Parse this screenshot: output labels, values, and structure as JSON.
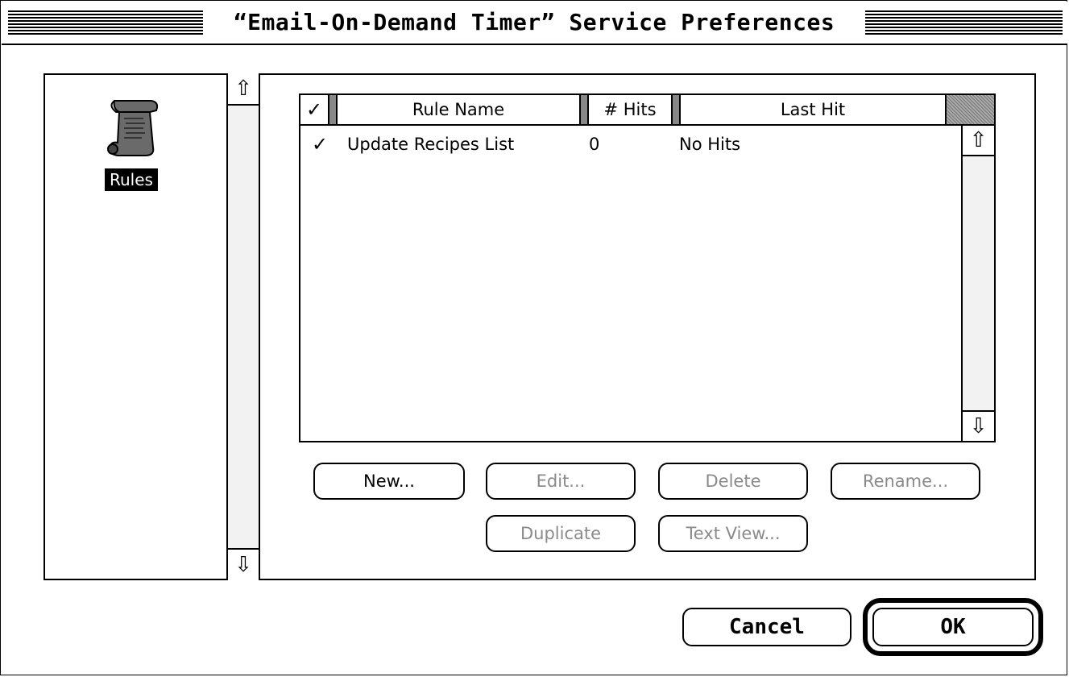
{
  "window": {
    "title": "“Email-On-Demand Timer” Service Preferences"
  },
  "categories": [
    {
      "label": "Rules",
      "icon": "scroll-icon",
      "selected": true
    }
  ],
  "table": {
    "columns": {
      "check": "✓",
      "name": "Rule Name",
      "hits": "# Hits",
      "last": "Last Hit"
    },
    "rows": [
      {
        "check": "✓",
        "name": "Update Recipes List",
        "hits": "0",
        "last": "No Hits"
      }
    ]
  },
  "buttons": {
    "new": "New...",
    "edit": "Edit...",
    "delete": "Delete",
    "rename": "Rename...",
    "duplicate": "Duplicate",
    "text_view": "Text View...",
    "cancel": "Cancel",
    "ok": "OK"
  },
  "colors": {
    "disabled_text": "#8a8a8a",
    "selection_bg": "#000000"
  }
}
